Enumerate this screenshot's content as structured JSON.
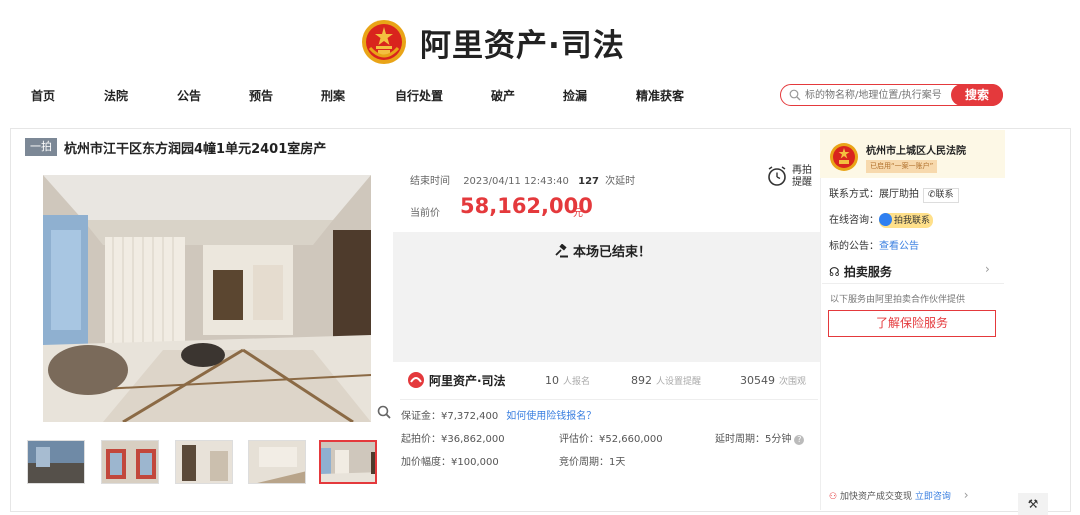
{
  "brand": {
    "name": "阿里资产·司法",
    "emblem": "court-emblem-icon"
  },
  "nav": [
    {
      "label": "首页"
    },
    {
      "label": "法院"
    },
    {
      "label": "公告"
    },
    {
      "label": "预告"
    },
    {
      "label": "刑案"
    },
    {
      "label": "自行处置"
    },
    {
      "label": "破产"
    },
    {
      "label": "捡漏"
    },
    {
      "label": "精准获客"
    }
  ],
  "search": {
    "placeholder": "标的物名称/地理位置/执行案号",
    "button": "搜索"
  },
  "item": {
    "tag": "一拍",
    "title": "杭州市江干区东方润园4幢1单元2401室房产"
  },
  "auction": {
    "end_label": "结束时间",
    "end_time": "2023/04/11 12:43:40",
    "delay_count": "127",
    "delay_label": "次延时",
    "price_label": "当前价",
    "price": "58,162,000",
    "price_unit": "元",
    "remind_label": "再拍提醒",
    "ended": "本场已结束！"
  },
  "stats": {
    "logo_text": "阿里资产·司法",
    "signups": "10",
    "signups_label": "人报名",
    "reminders": "892",
    "reminders_label": "人设置提醒",
    "views": "30549",
    "views_label": "次围观"
  },
  "details": {
    "deposit": "保证金：¥7,372,400",
    "deposit_link": "如何使用险钱报名？",
    "start_price": "起拍价：¥36,862,000",
    "estimate": "评估价：¥52,660,000",
    "delay_period": "延时周期：5分钟",
    "increment": "加价幅度：¥100,000",
    "bid_period": "竞价周期：1天"
  },
  "court": {
    "name": "杭州市上城区人民法院",
    "badge": "已启用“一案一账户”",
    "contact_label": "联系方式：",
    "contact_value": "展厅助拍",
    "contact_button": "联系",
    "online_label": "在线咨询：",
    "online_button": "拍我联系",
    "notice_label": "标的公告：",
    "notice_link": "查看公告"
  },
  "service": {
    "title": "拍卖服务",
    "note": "以下服务由阿里拍卖合作伙伴提供",
    "button": "了解保险服务"
  },
  "fast": {
    "text": "加快资产成交变现",
    "link": "立即咨询"
  },
  "colors": {
    "accent": "#e4393c",
    "link": "#3a7fe0",
    "tag": "#7c8896"
  }
}
